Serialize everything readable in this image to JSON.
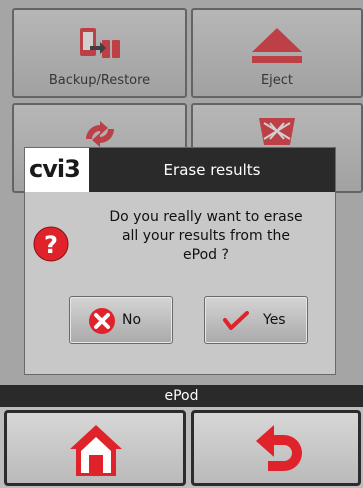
{
  "tiles": {
    "backup_label": "Backup/Restore",
    "eject_label": "Eject"
  },
  "dialog": {
    "logo_text": "cvi3",
    "title": "Erase results",
    "message_line1": "Do you really want to erase",
    "message_line2": "all your results from the",
    "message_line3": "ePod ?",
    "no_label": "No",
    "yes_label": "Yes"
  },
  "statusbar": {
    "label": "ePod"
  },
  "colors": {
    "accent_red": "#e0232b",
    "dark_bar": "#2a2a2a"
  }
}
